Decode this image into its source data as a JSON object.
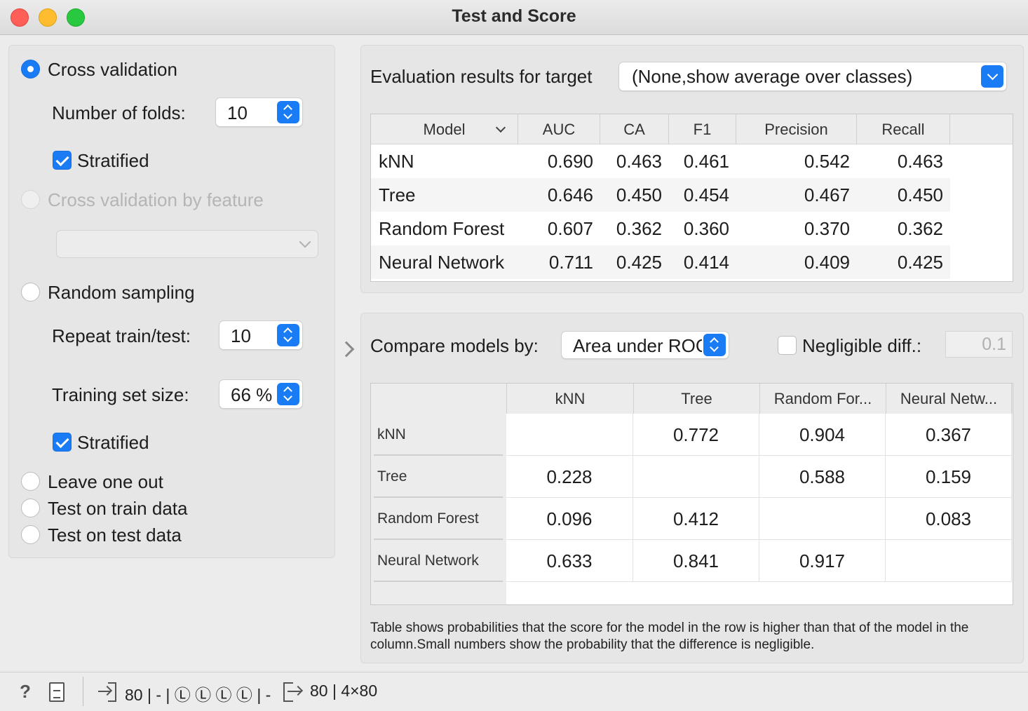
{
  "window": {
    "title": "Test and Score"
  },
  "sampling": {
    "cross_validation": {
      "label": "Cross validation",
      "selected": true
    },
    "folds": {
      "label": "Number of folds:",
      "value": "10"
    },
    "stratified_cv": {
      "label": "Stratified",
      "checked": true
    },
    "cv_by_feature": {
      "label": "Cross validation by feature",
      "enabled": false
    },
    "random_sampling": {
      "label": "Random sampling",
      "selected": false
    },
    "repeat": {
      "label": "Repeat train/test:",
      "value": "10"
    },
    "train_size": {
      "label": "Training set size:",
      "value": "66 %"
    },
    "stratified_rs": {
      "label": "Stratified",
      "checked": true
    },
    "leave_one_out": {
      "label": "Leave one out"
    },
    "test_on_train": {
      "label": "Test on train data"
    },
    "test_on_test": {
      "label": "Test on test data"
    }
  },
  "evaluation": {
    "target_label": "Evaluation results for target",
    "target_value": "(None,show average over classes)",
    "columns": [
      "Model",
      "AUC",
      "CA",
      "F1",
      "Precision",
      "Recall"
    ],
    "rows": [
      {
        "model": "kNN",
        "values": [
          "0.690",
          "0.463",
          "0.461",
          "0.542",
          "0.463"
        ]
      },
      {
        "model": "Tree",
        "values": [
          "0.646",
          "0.450",
          "0.454",
          "0.467",
          "0.450"
        ]
      },
      {
        "model": "Random Forest",
        "values": [
          "0.607",
          "0.362",
          "0.360",
          "0.370",
          "0.362"
        ]
      },
      {
        "model": "Neural Network",
        "values": [
          "0.711",
          "0.425",
          "0.414",
          "0.409",
          "0.425"
        ]
      }
    ]
  },
  "comparison": {
    "compare_label": "Compare models by:",
    "compare_value": "Area under ROC",
    "negligible_label": "Negligible diff.:",
    "negligible_checked": false,
    "negligible_value": "0.1",
    "columns": [
      "kNN",
      "Tree",
      "Random For...",
      "Neural Netw..."
    ],
    "rows": [
      {
        "model": "kNN",
        "values": [
          "",
          "0.772",
          "0.904",
          "0.367"
        ]
      },
      {
        "model": "Tree",
        "values": [
          "0.228",
          "",
          "0.588",
          "0.159"
        ]
      },
      {
        "model": "Random Forest",
        "values": [
          "0.096",
          "0.412",
          "",
          "0.083"
        ]
      },
      {
        "model": "Neural Network",
        "values": [
          "0.633",
          "0.841",
          "0.917",
          ""
        ]
      }
    ],
    "note": "Table shows probabilities that the score for the model in the row is higher than that of the model in the column.Small numbers show the probability that the difference is negligible."
  },
  "statusbar": {
    "input_summary": "80 | - | Ⓛ Ⓛ Ⓛ Ⓛ | -",
    "output_summary": "80 | 4×80"
  },
  "colors": {
    "accent": "#1a7cf5",
    "panel": "#e6e6e6",
    "window": "#ececec"
  }
}
